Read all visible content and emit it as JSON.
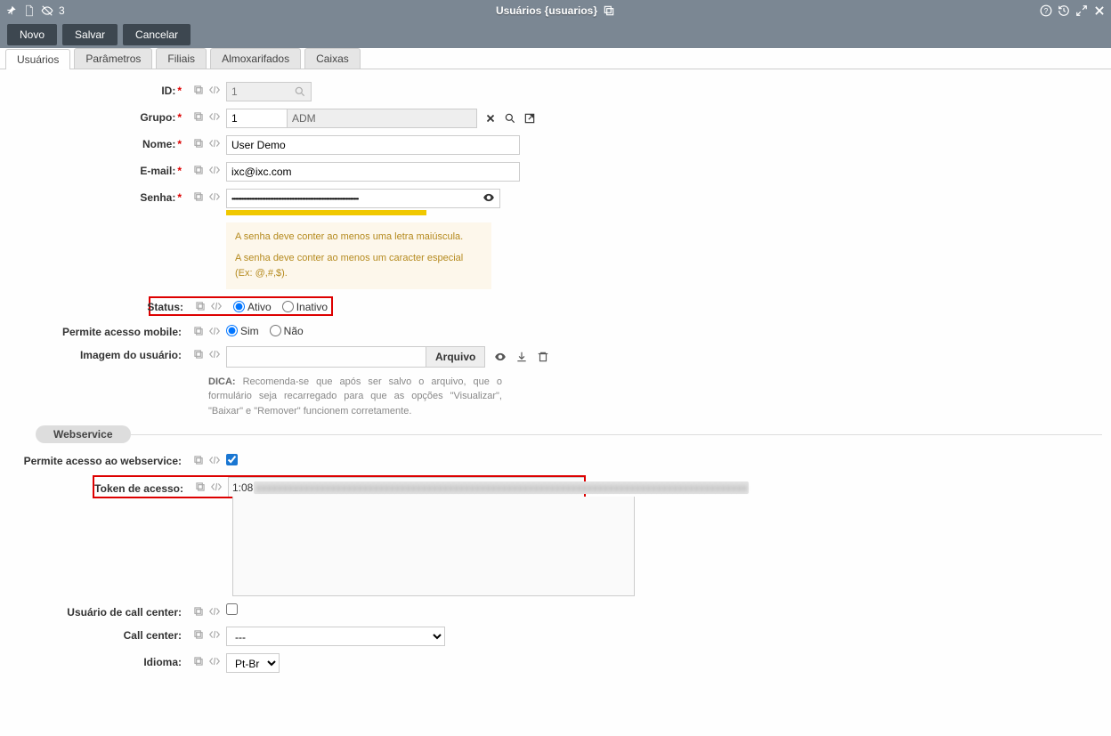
{
  "header": {
    "left_count": "3",
    "title": "Usuários {usuarios}"
  },
  "toolbar": {
    "novo": "Novo",
    "salvar": "Salvar",
    "cancelar": "Cancelar"
  },
  "tabs": [
    "Usuários",
    "Parâmetros",
    "Filiais",
    "Almoxarifados",
    "Caixas"
  ],
  "form": {
    "id": {
      "label": "ID:",
      "value": "1"
    },
    "grupo": {
      "label": "Grupo:",
      "id": "1",
      "name": "ADM"
    },
    "nome": {
      "label": "Nome:",
      "value": "User Demo"
    },
    "email": {
      "label": "E-mail:",
      "value": "ixc@ixc.com"
    },
    "senha": {
      "label": "Senha:",
      "value": "•••••••••••••••••••••••••••••••••••••••••••••••••••••••••••••••••••••••••••••••",
      "hint1": "A senha deve conter ao menos uma letra maiúscula.",
      "hint2": "A senha deve conter ao menos um caracter especial (Ex: @,#,$)."
    },
    "status": {
      "label": "Status:",
      "opt1": "Ativo",
      "opt2": "Inativo"
    },
    "mobile": {
      "label": "Permite acesso mobile:",
      "opt1": "Sim",
      "opt2": "Não"
    },
    "imagem": {
      "label": "Imagem do usuário:",
      "button": "Arquivo"
    },
    "dica": {
      "label": "DICA:",
      "text": "Recomenda-se que após ser salvo o arquivo, que o formulário seja recarregado para que as opções \"Visualizar\", \"Baixar\" e \"Remover\" funcionem corretamente."
    },
    "section_webservice": "Webservice",
    "ws_permite": {
      "label": "Permite acesso ao webservice:"
    },
    "token": {
      "label": "Token de acesso:",
      "prefix": "1:08",
      "hidden": "xxxxxxxxxxxxxxxxxxxxxxxxxxxxxxxxxxxxxxxxxxxxxxxxxxxxxxxxxxxxxxxxxxxxxxxxxxxxxxxxxxxxxxxxxxxx"
    },
    "callcenter_user": {
      "label": "Usuário de call center:"
    },
    "callcenter": {
      "label": "Call center:",
      "value": "---"
    },
    "idioma": {
      "label": "Idioma:",
      "value": "Pt-Br"
    }
  }
}
